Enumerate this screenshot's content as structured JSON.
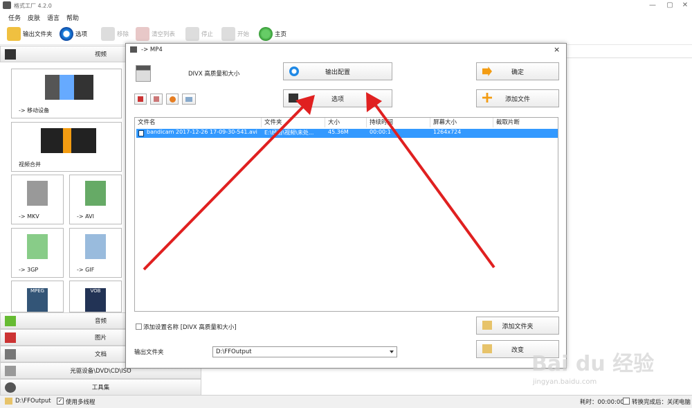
{
  "app": {
    "title": "格式工厂 4.2.0",
    "min": "—",
    "max": "▢",
    "close": "✕"
  },
  "menu": [
    "任务",
    "皮肤",
    "语言",
    "帮助"
  ],
  "toolbar": {
    "output_folder": "输出文件夹",
    "options": "选项",
    "remove": "移除",
    "clear_list": "清空列表",
    "stop": "停止",
    "start": "开始",
    "home": "主页"
  },
  "sidebar": {
    "video_header": "视频",
    "tiles": [
      {
        "label": "-> 移动设备"
      },
      {
        "label": "视频合并"
      },
      {
        "label": "-> MKV"
      },
      {
        "label": "-> AVI"
      },
      {
        "label": "-> 3GP"
      },
      {
        "label": "-> GIF"
      },
      {
        "badge1": "MPEG",
        "badge2": "VOB"
      }
    ],
    "audio": "音频",
    "image": "图片",
    "document": "文档",
    "optical": "光驱设备\\DVD\\CD\\ISO",
    "tools": "工具集"
  },
  "dialog": {
    "title": "-> MP4",
    "profile": "DIVX 高质量和大小",
    "output_config": "输出配置",
    "options": "选项",
    "ok": "确定",
    "add_file": "添加文件",
    "columns": [
      "文件名",
      "文件夹",
      "大小",
      "持续时间",
      "屏幕大小",
      "截取片断"
    ],
    "rows": [
      {
        "name": "bandicam 2017-12-26 17-09-30-541.avi",
        "folder": "E:\\经验\\视频\\未处...",
        "size": "45.36M",
        "duration": "00:00:1",
        "screen": "1264x724",
        "clip": ""
      }
    ],
    "add_name_check": "添加设置名称 [DIVX 高质量和大小]",
    "output_folder_label": "输出文件夹",
    "output_folder_value": "D:\\FFOutput",
    "add_folder": "添加文件夹",
    "change": "改变",
    "close": "×"
  },
  "statusbar": {
    "path": "D:\\FFOutput",
    "multithread": "使用多线程",
    "elapsed": "耗时：00:00:00",
    "after_convert": "转换完成后：关闭电脑"
  },
  "watermark": {
    "text": "Bai du 经验",
    "url": "jingyan.baidu.com"
  },
  "colors": {
    "selection": "#3399ff",
    "arrow": "#e02020",
    "accent": "#1e88e5"
  }
}
